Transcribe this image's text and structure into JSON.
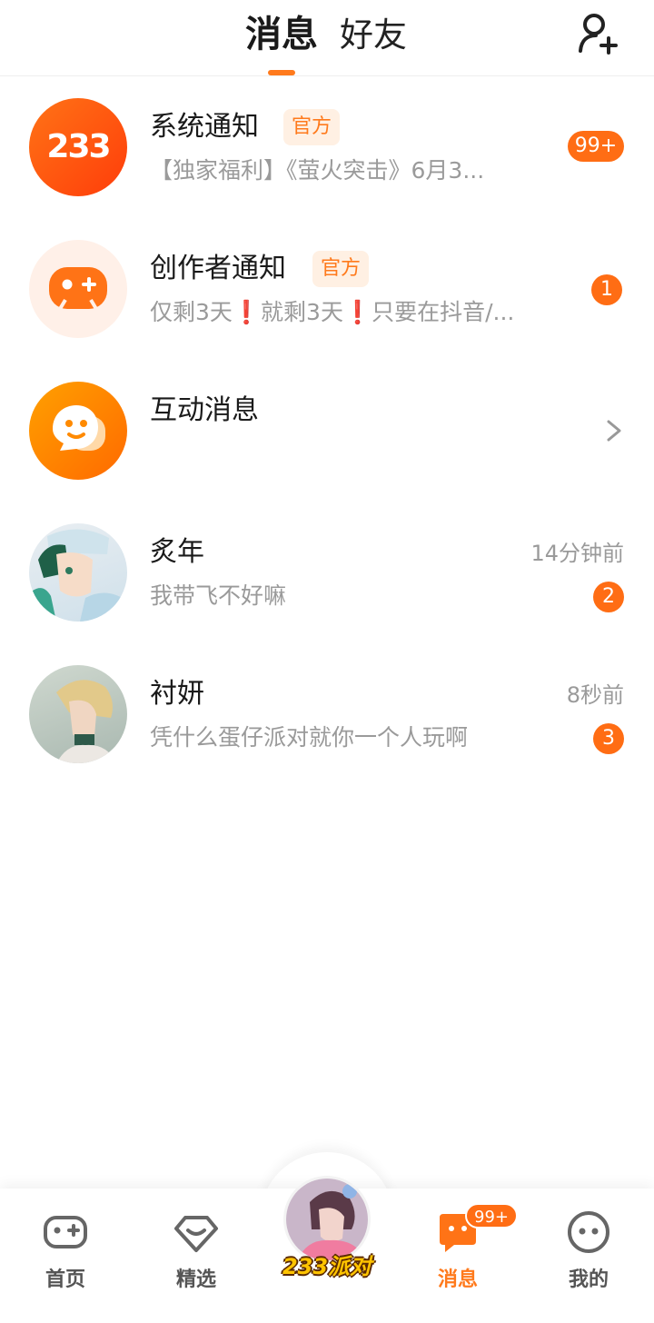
{
  "header": {
    "tab_messages": "消息",
    "tab_friends": "好友"
  },
  "conversations": [
    {
      "name": "系统通知",
      "tag": "官方",
      "preview": "【独家福利】《萤火突击》6月3...",
      "badge": "99+",
      "avatar_text": "233"
    },
    {
      "name": "创作者通知",
      "tag": "官方",
      "preview": "仅剩3天❗就剩3天❗只要在抖音/...",
      "badge": "1"
    },
    {
      "name": "互动消息"
    },
    {
      "name": "炙年",
      "preview": "我带飞不好嘛",
      "time": "14分钟前",
      "badge": "2"
    },
    {
      "name": "衬妍",
      "preview": "凭什么蛋仔派对就你一个人玩啊",
      "time": "8秒前",
      "badge": "3"
    }
  ],
  "bottom_nav": {
    "home": "首页",
    "featured": "精选",
    "center_logo": "233派对",
    "messages": "消息",
    "messages_badge": "99+",
    "me": "我的"
  },
  "colors": {
    "accent": "#ff7a1c",
    "badge": "#ff6d14",
    "tag_bg": "#fff0e3"
  }
}
